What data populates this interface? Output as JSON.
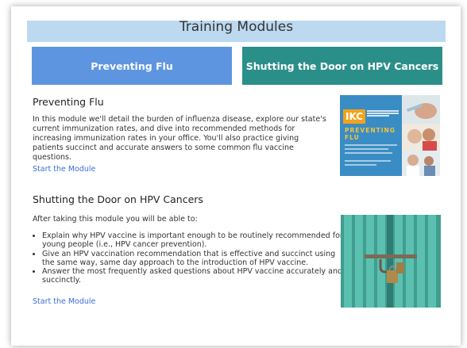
{
  "page": {
    "title": "Training Modules"
  },
  "tabs": [
    {
      "label": "Preventing Flu",
      "color": "#5e95e1"
    },
    {
      "label": "Shutting the Door on HPV Cancers",
      "color": "#2b8f89"
    }
  ],
  "modules": {
    "flu": {
      "title": "Preventing Flu",
      "description": "In this module we'll detail the burden of influenza disease, explore our state's current immunization rates, and dive into recommended methods for increasing immunization rates in your office. You'll also practice giving patients succinct and accurate answers to some common flu vaccine questions.",
      "link": "Start the Module",
      "thumbnail": {
        "logo_text": "IKC",
        "word": "PREVENTING FLU"
      }
    },
    "hpv": {
      "title": "Shutting the Door on HPV Cancers",
      "intro": "After taking this module you will be able to:",
      "bullets": [
        "Explain why HPV vaccine is important enough to be routinely recommended for young people (i.e., HPV cancer prevention).",
        "Give an HPV vaccination recommendation that is effective and succinct using the same way, same day approach to the introduction of HPV vaccine.",
        "Answer the most frequently asked questions about HPV vaccine accurately and succinctly."
      ],
      "link": "Start the Module"
    }
  },
  "colors": {
    "title_bar": "#bcd9f0",
    "link": "#3a6fd8",
    "flu_thumb_bg": "#3a8dc4",
    "logo": "#f2a31b",
    "hpv_door": "#4fb3a3"
  }
}
